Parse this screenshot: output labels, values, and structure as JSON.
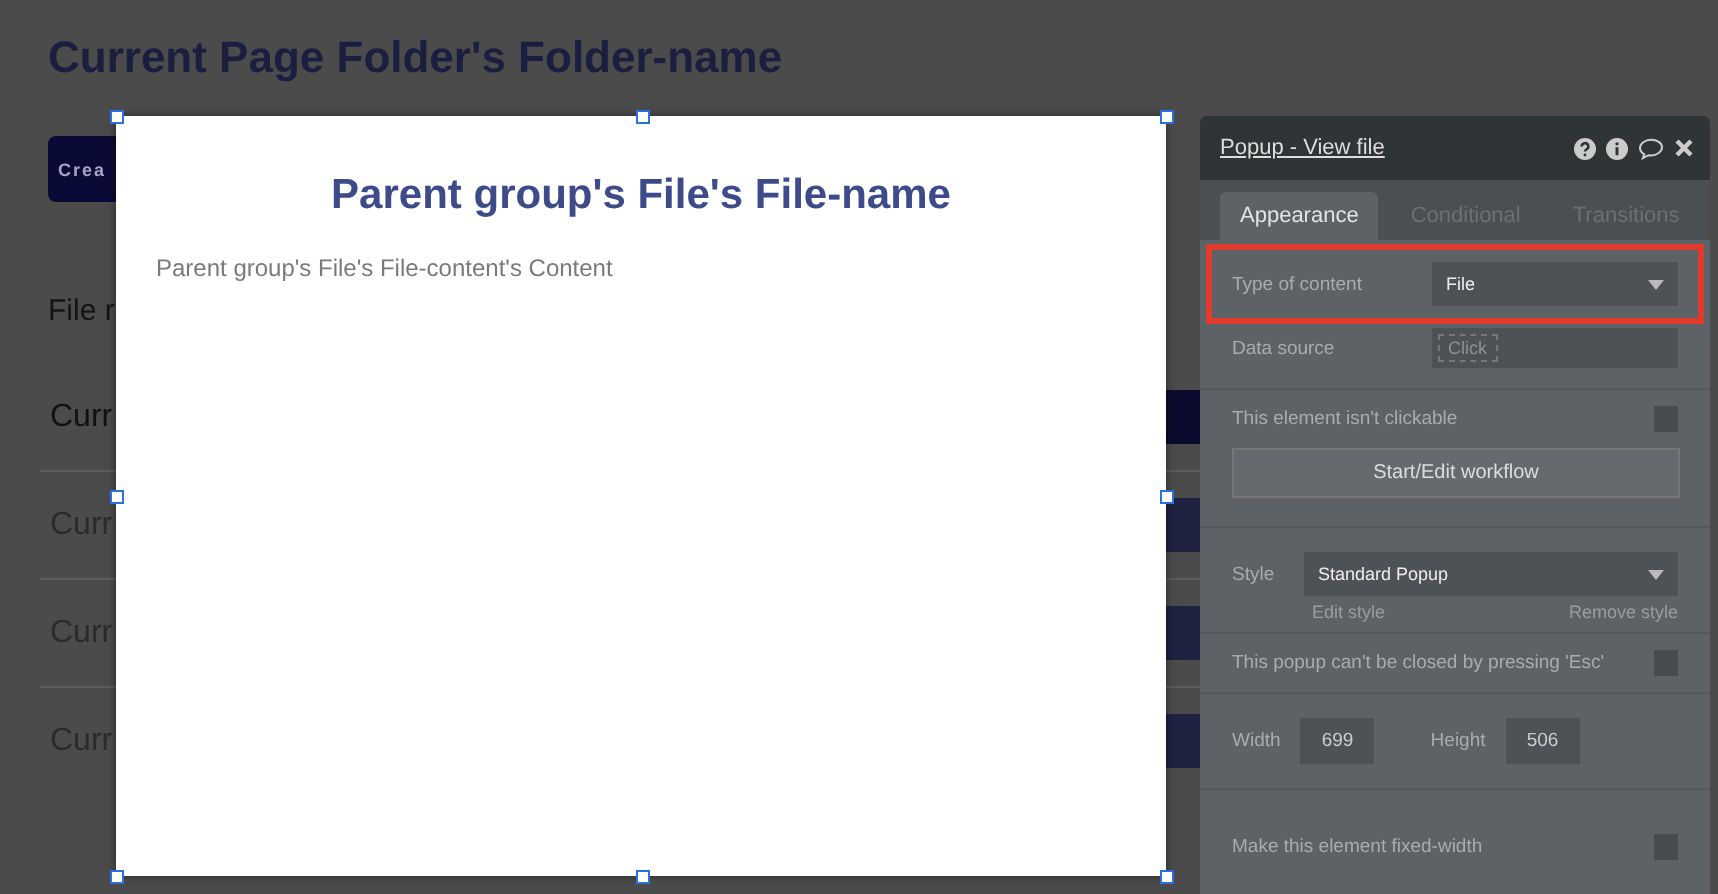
{
  "page": {
    "title": "Current Page Folder's Folder-name",
    "create_button": "Crea",
    "section_label": "File r",
    "rows": [
      {
        "name": "Curr",
        "highlighted": true
      },
      {
        "name": "Curr",
        "highlighted": false
      },
      {
        "name": "Curr",
        "highlighted": false
      },
      {
        "name": "Curr",
        "highlighted": false
      }
    ]
  },
  "popup": {
    "title": "Parent group's File's File-name",
    "content": "Parent group's File's File-content's Content",
    "selected": true
  },
  "panel": {
    "title": "Popup - View file",
    "tabs": [
      {
        "label": "Appearance",
        "selected": true
      },
      {
        "label": "Conditional",
        "selected": false
      },
      {
        "label": "Transitions",
        "selected": false
      }
    ],
    "type_of_content": {
      "label": "Type of content",
      "value": "File",
      "highlighted": true
    },
    "data_source": {
      "label": "Data source",
      "placeholder": "Click"
    },
    "not_clickable": {
      "label": "This element isn't clickable",
      "checked": false
    },
    "workflow_button": "Start/Edit workflow",
    "style": {
      "label": "Style",
      "value": "Standard Popup",
      "edit": "Edit style",
      "remove": "Remove style"
    },
    "esc": {
      "label": "This popup can't be closed by pressing 'Esc'",
      "checked": false
    },
    "width": {
      "label": "Width",
      "value": "699"
    },
    "height": {
      "label": "Height",
      "value": "506"
    },
    "fixed_width": {
      "label": "Make this element fixed-width",
      "checked": false
    }
  }
}
